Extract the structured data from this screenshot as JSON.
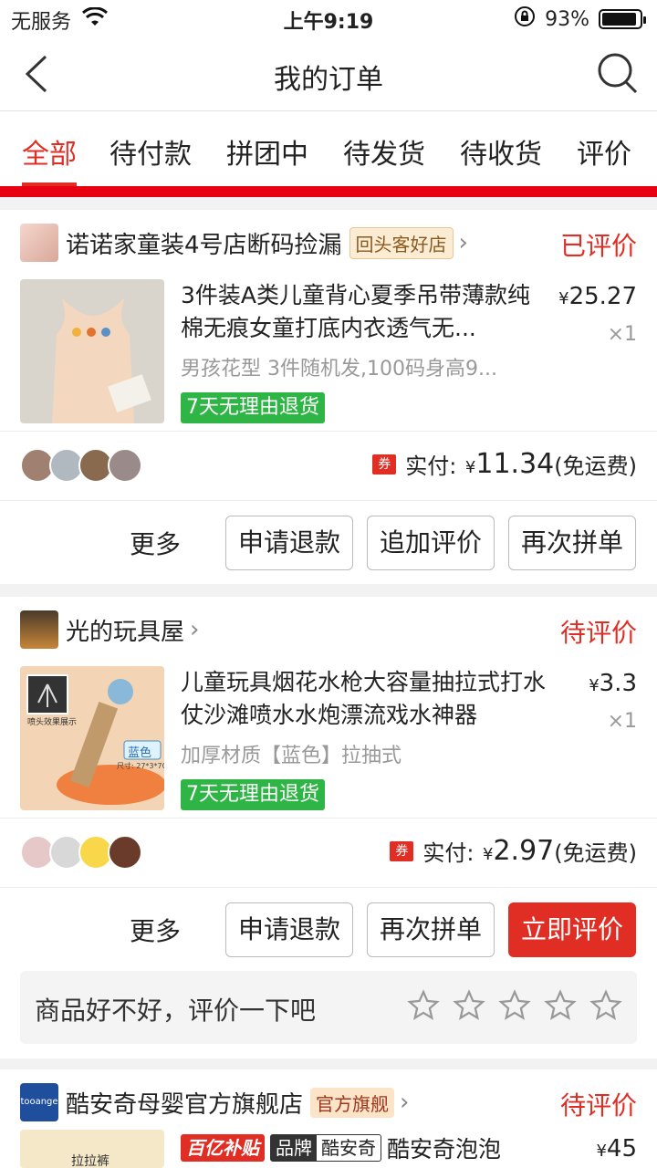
{
  "status_bar": {
    "carrier": "无服务",
    "time": "上午9:19",
    "battery": "93%",
    "battery_level": 0.93
  },
  "nav": {
    "title": "我的订单"
  },
  "tabs": [
    "全部",
    "待付款",
    "拼团中",
    "待发货",
    "待收货",
    "评价"
  ],
  "orders": [
    {
      "shop": "诺诺家童装4号店断码捡漏",
      "shop_tag": "回头客好店",
      "status": "已评价",
      "title": "3件装A类儿童背心夏季吊带薄款纯棉无痕女童打底内衣透气无...",
      "spec": "男孩花型 3件随机发,100码身高9...",
      "badge": "7天无理由退货",
      "price_symbol": "¥",
      "price": "25.27",
      "qty": "×1",
      "pay_label": "实付:",
      "pay_amount": "11.34",
      "shipping": "(免运费)",
      "coupon": "券",
      "more": "更多",
      "buttons": [
        "申请退款",
        "追加评价",
        "再次拼单"
      ]
    },
    {
      "shop": "光的玩具屋",
      "status": "待评价",
      "title": "儿童玩具烟花水枪大容量抽拉式打水仗沙滩喷水水炮漂流戏水神器",
      "spec": "加厚材质【蓝色】拉抽式",
      "badge": "7天无理由退货",
      "price_symbol": "¥",
      "price": "3.3",
      "qty": "×1",
      "pay_label": "实付:",
      "pay_amount": "2.97",
      "shipping": "(免运费)",
      "coupon": "券",
      "more": "更多",
      "buttons": [
        "申请退款",
        "再次拼单",
        "立即评价"
      ],
      "rate_prompt": "商品好不好，评价一下吧",
      "image_labels": {
        "label": "蓝色",
        "size": "尺寸: 27*3*7CM",
        "box": "喷头效果展示"
      }
    },
    {
      "shop": "酷安奇母婴官方旗舰店",
      "shop_logo": "tooange",
      "shop_tag": "官方旗舰",
      "status": "待评价",
      "title_tags": [
        "百亿补贴",
        "品牌",
        "酷安奇"
      ],
      "title": "酷安奇泡泡",
      "price_symbol": "¥",
      "price": "45",
      "image_label": "拉拉裤"
    }
  ],
  "colors": {
    "accent": "#e02e24",
    "green_badge": "#2fb545",
    "divider_red": "#e60012"
  }
}
